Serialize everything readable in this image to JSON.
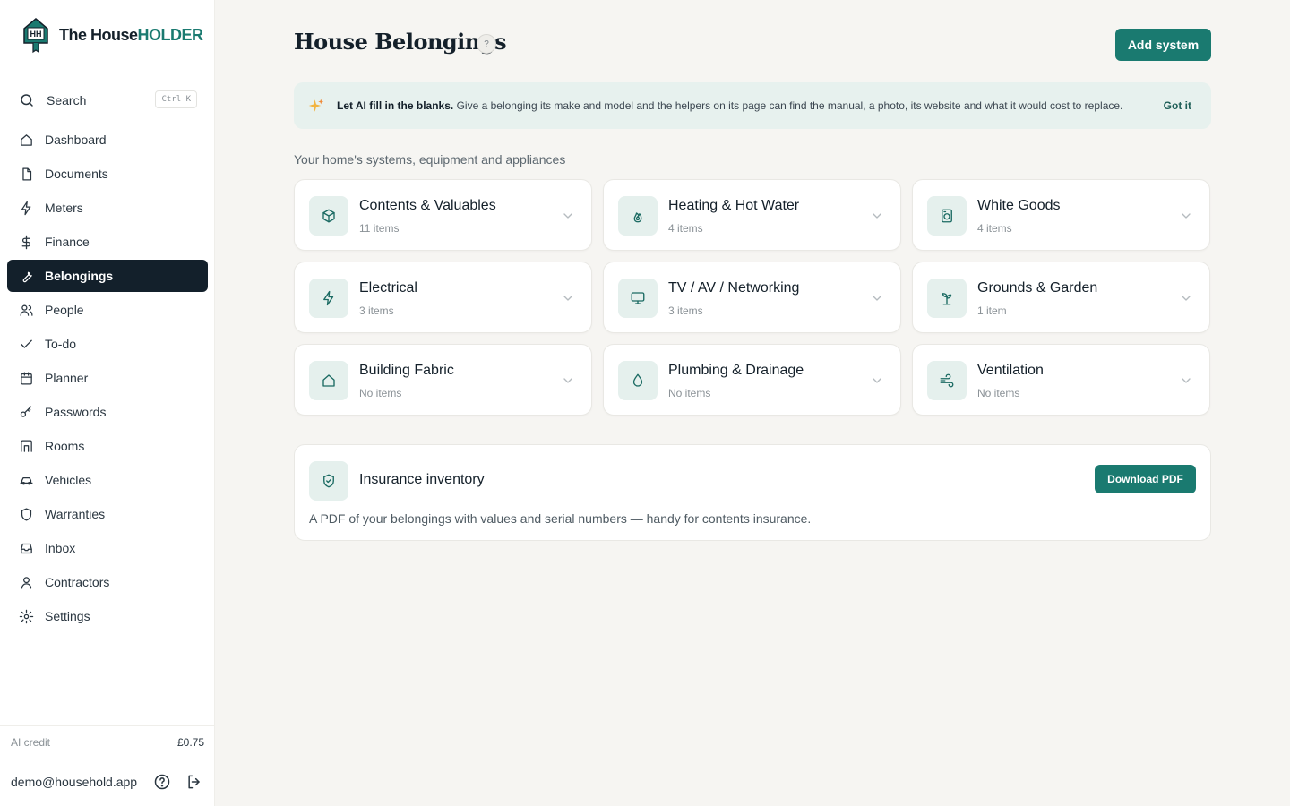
{
  "brand": {
    "name_part1": "The House",
    "name_part2": "HOLDER",
    "logo_text": "HH"
  },
  "search": {
    "label": "Search",
    "shortcut": "Ctrl K"
  },
  "nav": [
    {
      "label": "Dashboard",
      "icon": "home-icon",
      "active": false
    },
    {
      "label": "Documents",
      "icon": "file-icon",
      "active": false
    },
    {
      "label": "Meters",
      "icon": "bolt-icon",
      "active": false
    },
    {
      "label": "Finance",
      "icon": "dollar-icon",
      "active": false
    },
    {
      "label": "Belongings",
      "icon": "wrench-icon",
      "active": true
    },
    {
      "label": "People",
      "icon": "users-icon",
      "active": false
    },
    {
      "label": "To-do",
      "icon": "check-icon",
      "active": false
    },
    {
      "label": "Planner",
      "icon": "calendar-icon",
      "active": false
    },
    {
      "label": "Passwords",
      "icon": "key-icon",
      "active": false
    },
    {
      "label": "Rooms",
      "icon": "door-icon",
      "active": false
    },
    {
      "label": "Vehicles",
      "icon": "car-icon",
      "active": false
    },
    {
      "label": "Warranties",
      "icon": "shield-icon",
      "active": false
    },
    {
      "label": "Inbox",
      "icon": "inbox-icon",
      "active": false
    },
    {
      "label": "Contractors",
      "icon": "person-icon",
      "active": false
    },
    {
      "label": "Settings",
      "icon": "gear-icon",
      "active": false
    }
  ],
  "ai_credit": {
    "label": "AI credit",
    "value": "£0.75"
  },
  "account": {
    "email": "demo@household.app"
  },
  "header": {
    "title": "House Belongings",
    "help": "?",
    "add_button": "Add system"
  },
  "banner": {
    "bold": "Let AI fill in the blanks.",
    "text": " Give a belonging its make and model and the helpers on its page can find the manual, a photo, its website and what it would cost to replace.",
    "dismiss": "Got it"
  },
  "section_label": "Your home's systems, equipment and appliances",
  "systems": [
    {
      "title": "Contents & Valuables",
      "count": "11 items",
      "icon": "box-icon"
    },
    {
      "title": "Heating & Hot Water",
      "count": "4 items",
      "icon": "flame-icon"
    },
    {
      "title": "White Goods",
      "count": "4 items",
      "icon": "washer-icon"
    },
    {
      "title": "Electrical",
      "count": "3 items",
      "icon": "bolt-icon"
    },
    {
      "title": "TV / AV / Networking",
      "count": "3 items",
      "icon": "monitor-icon"
    },
    {
      "title": "Grounds & Garden",
      "count": "1 item",
      "icon": "sprout-icon"
    },
    {
      "title": "Building Fabric",
      "count": "No items",
      "icon": "house-icon"
    },
    {
      "title": "Plumbing & Drainage",
      "count": "No items",
      "icon": "droplet-icon"
    },
    {
      "title": "Ventilation",
      "count": "No items",
      "icon": "wind-icon"
    }
  ],
  "insurance": {
    "title": "Insurance inventory",
    "description": "A PDF of your belongings with values and serial numbers — handy for contents insurance.",
    "button": "Download PDF"
  },
  "colors": {
    "accent": "#1a7a70",
    "active_nav": "#13202b",
    "icon_bg": "#e5f0ed"
  }
}
